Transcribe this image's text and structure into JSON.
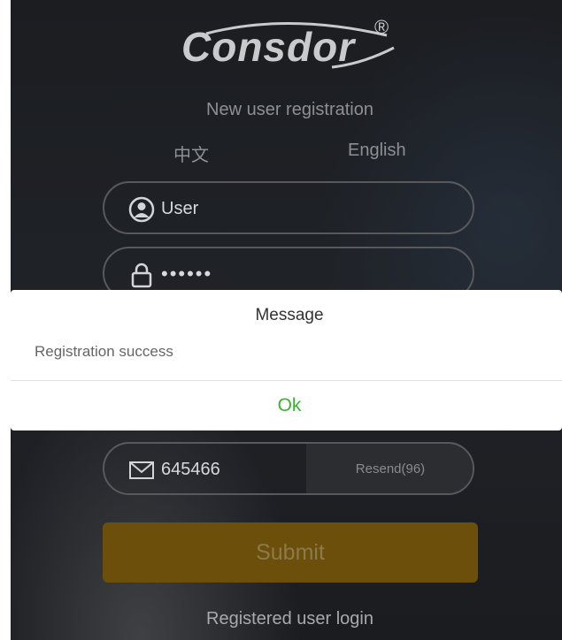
{
  "logo": {
    "text": "Consdor",
    "registered": "®"
  },
  "header": {
    "title": "New user registration"
  },
  "language": {
    "chinese": "中文",
    "english": "English"
  },
  "form": {
    "username": "User",
    "password_mask": "••••••",
    "verification_code": "645466",
    "resend_label": "Resend(96)",
    "submit_label": "Submit"
  },
  "footer": {
    "login_link": "Registered user login"
  },
  "dialog": {
    "title": "Message",
    "message": "Registration success",
    "ok_label": "Ok"
  },
  "colors": {
    "accent_ok": "#3bb22f",
    "submit_bg": "#6b4f0a",
    "background": "#1a1c20"
  }
}
